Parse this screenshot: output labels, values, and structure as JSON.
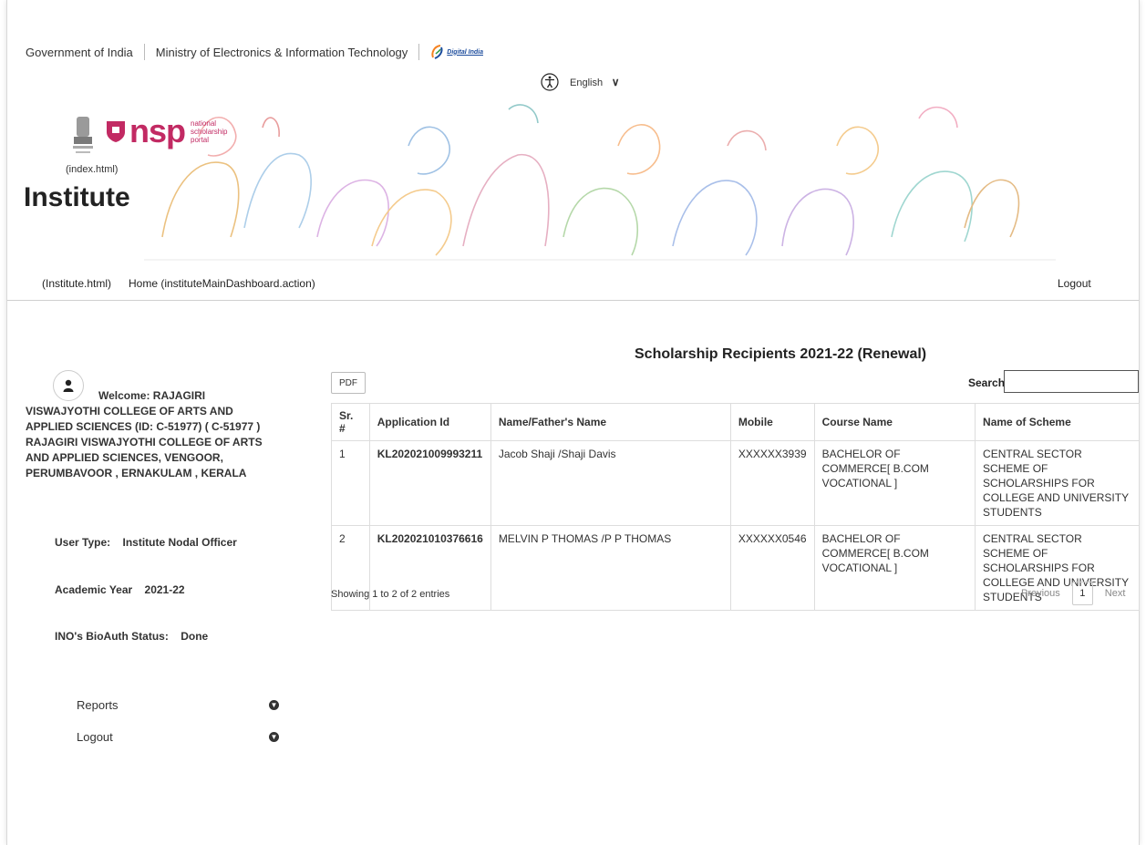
{
  "gov_bar": {
    "gov": "Government of India",
    "ministry": "Ministry of Electronics & Information Technology",
    "digital_india": "Digital India"
  },
  "language": {
    "selected": "English"
  },
  "logo": {
    "nsp": "nsp",
    "nsp_sub1": "national",
    "nsp_sub2": "scholarship",
    "nsp_sub3": "portal",
    "index_link": "(index.html)"
  },
  "page_heading": "Institute",
  "nav": {
    "institute_link": "(Institute.html)",
    "home_link": "Home (instituteMainDashboard.action)",
    "logout": "Logout"
  },
  "sidebar": {
    "welcome": "Welcome: RAJAGIRI VISWAJYOTHI COLLEGE OF ARTS AND APPLIED SCIENCES (ID: C-51977) ( C-51977 ) RAJAGIRI VISWAJYOTHI COLLEGE OF ARTS AND APPLIED SCIENCES, VENGOOR, PERUMBAVOOR , ERNAKULAM , KERALA",
    "user_type_label": "User Type:",
    "user_type_value": "Institute Nodal Officer",
    "academic_year_label": "Academic Year",
    "academic_year_value": "2021-22",
    "bioauth_label": "INO's BioAuth Status:",
    "bioauth_value": "Done",
    "menu": [
      {
        "label": "Reports"
      },
      {
        "label": "Logout"
      }
    ]
  },
  "main": {
    "title": "Scholarship Recipients 2021-22 (Renewal)",
    "pdf_button": "PDF",
    "search_label": "Search:",
    "search_value": "",
    "columns": [
      "Sr. #",
      "Application Id",
      "Name/Father's Name",
      "Mobile",
      "Course Name",
      "Name of Scheme"
    ],
    "rows": [
      [
        "1",
        "KL202021009993211",
        "Jacob Shaji /Shaji Davis",
        "XXXXXX3939",
        "BACHELOR OF COMMERCE[ B.COM VOCATIONAL ]",
        "CENTRAL SECTOR SCHEME OF SCHOLARSHIPS FOR COLLEGE AND UNIVERSITY STUDENTS"
      ],
      [
        "2",
        "KL202021010376616",
        "MELVIN P THOMAS /P P THOMAS",
        "XXXXXX0546",
        "BACHELOR OF COMMERCE[ B.COM VOCATIONAL ]",
        "CENTRAL SECTOR SCHEME OF SCHOLARSHIPS FOR COLLEGE AND UNIVERSITY STUDENTS"
      ]
    ],
    "showing": "Showing 1 to 2 of 2 entries",
    "pager": {
      "previous": "Previous",
      "page": "1",
      "next": "Next"
    }
  },
  "colors": {
    "nsp_brand": "#c22a63",
    "text": "#222222",
    "border": "#dddddd"
  }
}
